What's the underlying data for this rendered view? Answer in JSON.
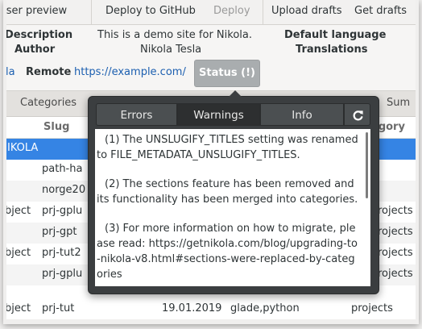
{
  "toolbar": {
    "items": [
      "vser preview",
      "Deploy to GitHub",
      "Deploy",
      "Upload drafts",
      "Get drafts"
    ]
  },
  "info": {
    "description_label": "Description",
    "description_value": "This is a demo site for Nikola.",
    "default_language_label": "Default language",
    "author_label": "Author",
    "author_value": "Nikola Tesla",
    "translations_label": "Translations"
  },
  "remote": {
    "left_fragment": "la",
    "label": "Remote",
    "url": "https://example.com/",
    "status_button": "Status (!)"
  },
  "tabs_row": {
    "categories": "Categories",
    "right_fragment": "Sum"
  },
  "table": {
    "headers": {
      "slug": "Slug",
      "category": "egory"
    },
    "rows": [
      {
        "a": "",
        "b": "IKOLA",
        "c": "",
        "d": "",
        "e": ""
      },
      {
        "a": "",
        "b": "path-ha",
        "c": "",
        "d": "",
        "e": ""
      },
      {
        "a": "",
        "b": "norge20",
        "c": "",
        "d": "",
        "e": ""
      },
      {
        "a": "bject",
        "b": "prj-gplu",
        "c": "",
        "d": "",
        "e": "rojects"
      },
      {
        "a": "",
        "b": "prj-gpt",
        "c": "",
        "d": "",
        "e": "rojects"
      },
      {
        "a": "bject",
        "b": "prj-tut2",
        "c": "",
        "d": "",
        "e": "rojects"
      },
      {
        "a": "",
        "b": "prj-gplu",
        "c": "",
        "d": "",
        "e": "rojects"
      },
      {
        "a": "bject",
        "b": "prj-tut",
        "c": "19.01.2019",
        "d": "glade,python",
        "e": "projects"
      }
    ]
  },
  "popover": {
    "tabs": [
      "Errors",
      "Warnings",
      "Info"
    ],
    "active_tab": "Warnings",
    "refresh_icon": "refresh-icon",
    "messages": [
      "(1) The UNSLUGIFY_TITLES setting was renamed to FILE_METADATA_UNSLUGIFY_TITLES.",
      "(2) The sections feature has been removed and its functionality has been merged into categories.",
      "(3) For more information on how to migrate, please read: https://getnikola.com/blog/upgrading-to-nikola-v8.html#sections-were-replaced-by-categories"
    ]
  }
}
